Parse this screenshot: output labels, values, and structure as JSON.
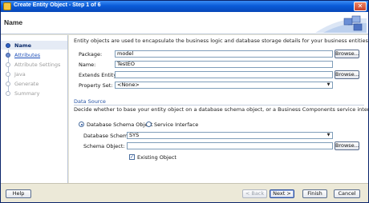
{
  "window": {
    "title": "Create Entity Object - Step 1 of 6",
    "close_glyph": "✕"
  },
  "header": {
    "title": "Name"
  },
  "nav": {
    "items": [
      {
        "label": "Name",
        "state": "active"
      },
      {
        "label": "Attributes",
        "state": "link"
      },
      {
        "label": "Attribute Settings",
        "state": "disabled"
      },
      {
        "label": "Java",
        "state": "disabled"
      },
      {
        "label": "Generate",
        "state": "disabled"
      },
      {
        "label": "Summary",
        "state": "disabled"
      }
    ]
  },
  "content": {
    "intro": "Entity objects are used to encapsulate the business logic and database storage details for your business entities.",
    "package": {
      "label": "Package:",
      "value": "model"
    },
    "name": {
      "label": "Name:",
      "value": "TestEO"
    },
    "extends": {
      "label": "Extends Entity:",
      "value": ""
    },
    "property_set": {
      "label": "Property Set:",
      "value": "<None>"
    },
    "browse_label": "Browse...",
    "data_source": {
      "title": "Data Source",
      "description": "Decide whether to base your entity object on a database schema object, or a Business Components service interface.",
      "radio_schema": "Database Schema Object",
      "radio_service": "Service Interface",
      "schema": {
        "label": "Database Schema:",
        "value": "SYS"
      },
      "schema_object": {
        "label": "Schema Object:",
        "value": ""
      },
      "existing_object": {
        "label": "Existing Object",
        "checked": true
      }
    }
  },
  "footer": {
    "help": "Help",
    "back": "< Back",
    "next": "Next >",
    "finish": "Finish",
    "cancel": "Cancel"
  },
  "icons": {
    "dropdown": "▼",
    "check": "✓"
  },
  "colors": {
    "titlebar": "#0a5bd9",
    "link": "#1e4fb8",
    "section": "#2653a6"
  }
}
